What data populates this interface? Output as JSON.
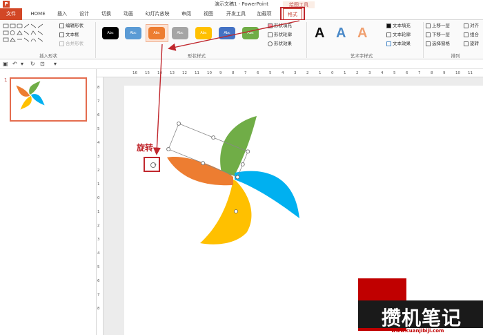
{
  "titlebar": {
    "logo": "P",
    "title": "演示文稿1 - PowerPoint",
    "context_tab": "绘图工具"
  },
  "tabs": [
    {
      "label": "文件"
    },
    {
      "label": "HOME"
    },
    {
      "label": "插入"
    },
    {
      "label": "设计"
    },
    {
      "label": "切换"
    },
    {
      "label": "动画"
    },
    {
      "label": "幻灯片放映"
    },
    {
      "label": "审阅"
    },
    {
      "label": "视图"
    },
    {
      "label": "开发工具"
    },
    {
      "label": "加载项"
    },
    {
      "label": "格式"
    }
  ],
  "ribbon": {
    "insert_shapes": {
      "edit_shape": "编辑形状",
      "text_box": "文本框",
      "merge_shapes": "合并形状",
      "label": "插入形状"
    },
    "shape_styles": {
      "label": "形状样式",
      "styles": [
        {
          "text": "Abc",
          "color": "#000000"
        },
        {
          "text": "Abc",
          "color": "#5b9bd5"
        },
        {
          "text": "Abc",
          "color": "#ed7d31"
        },
        {
          "text": "Abc",
          "color": "#a5a5a5"
        },
        {
          "text": "Abc",
          "color": "#ffc000"
        },
        {
          "text": "Abc",
          "color": "#4472c4"
        },
        {
          "text": "Abc",
          "color": "#70ad47"
        }
      ],
      "fill": "形状填充",
      "outline": "形状轮廓",
      "effects": "形状效果"
    },
    "wordart": {
      "label": "艺术字样式",
      "samples": [
        {
          "text": "A",
          "color": "#111111"
        },
        {
          "text": "A",
          "color": "#4a89c8"
        },
        {
          "text": "A",
          "color": "#f0a070"
        }
      ],
      "text_fill": "文本填充",
      "text_outline": "文本轮廓",
      "text_effects": "文本效果"
    },
    "arrange": {
      "label": "排列",
      "bring_forward": "上移一层",
      "send_backward": "下移一层",
      "selection_pane": "选择窗格",
      "align": "对齐",
      "group": "组合",
      "rotate": "旋转"
    }
  },
  "thumbnails": {
    "slide_number": "1"
  },
  "ruler": {
    "h_ticks": [
      "16",
      "15",
      "14",
      "13",
      "12",
      "11",
      "10",
      "9",
      "8",
      "7",
      "6",
      "5",
      "4",
      "3",
      "2",
      "1",
      "0",
      "1",
      "2",
      "3",
      "4",
      "5",
      "6",
      "7",
      "8",
      "9",
      "10",
      "11"
    ],
    "v_ticks": [
      "8",
      "7",
      "6",
      "5",
      "4",
      "3",
      "2",
      "1",
      "0",
      "1",
      "2",
      "3",
      "4",
      "5",
      "6",
      "7",
      "8"
    ]
  },
  "annotation": {
    "rotate_label": "旋转"
  },
  "watermark": {
    "brand": "攒机笔记",
    "url": "www.cuanjibiji.com"
  }
}
